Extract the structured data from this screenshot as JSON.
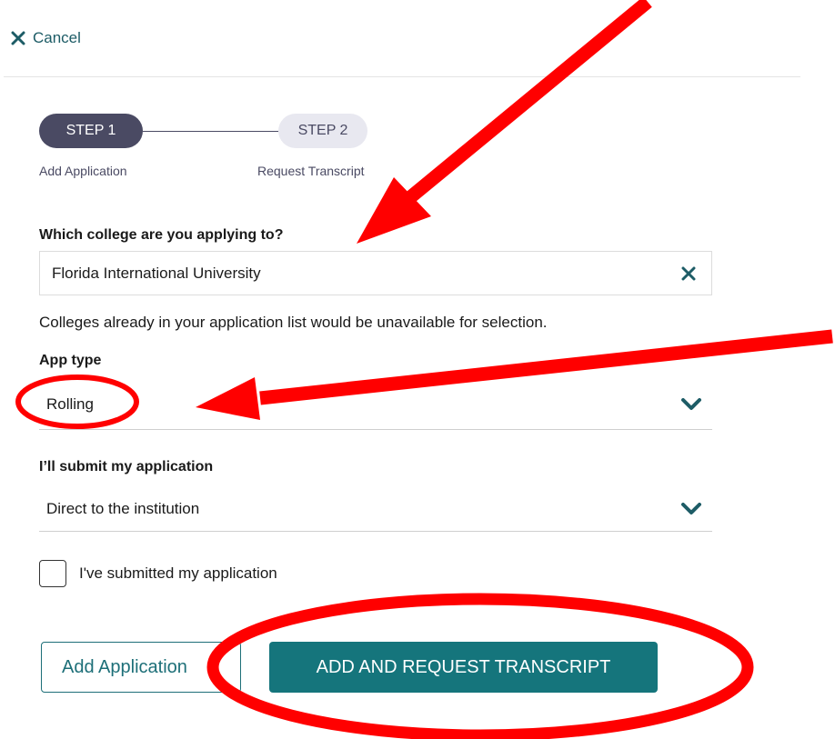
{
  "header": {
    "cancel_label": "Cancel",
    "cancel_icon": "close-icon"
  },
  "stepper": {
    "steps": [
      {
        "label": "STEP 1",
        "caption": "Add Application",
        "active": true
      },
      {
        "label": "STEP 2",
        "caption": "Request Transcript",
        "active": false
      }
    ]
  },
  "form": {
    "college": {
      "label": "Which college are you applying to?",
      "value": "Florida International University",
      "clear_icon": "close-icon",
      "hint": "Colleges already in your application list would be unavailable for selection."
    },
    "app_type": {
      "label": "App type",
      "value": "Rolling",
      "icon": "chevron-down-icon"
    },
    "submit_method": {
      "label": "I’ll submit my application",
      "value": "Direct to the institution",
      "icon": "chevron-down-icon"
    },
    "submitted_checkbox": {
      "label": "I've submitted my application",
      "checked": false
    }
  },
  "actions": {
    "secondary_label": "Add Application",
    "primary_label": "ADD AND REQUEST TRANSCRIPT"
  },
  "colors": {
    "teal": "#15757c",
    "dark_teal": "#1d5c66",
    "step_active": "#4a4a63",
    "step_inactive": "#e8e8f0",
    "annotation_red": "#ff0000"
  }
}
